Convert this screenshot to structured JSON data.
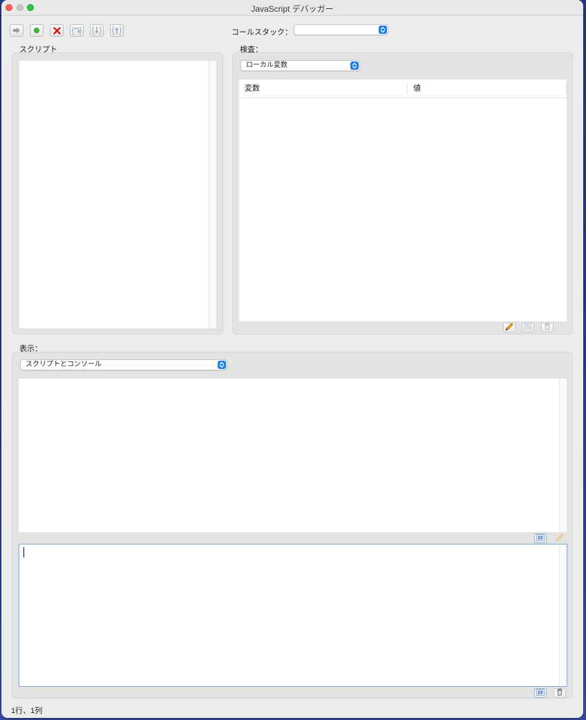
{
  "window": {
    "title": "JavaScript デバッガー"
  },
  "toolbar": {
    "buttons": [
      {
        "name": "continue",
        "icon": "arrow-right-icon"
      },
      {
        "name": "run",
        "icon": "green-dot-icon"
      },
      {
        "name": "stop",
        "icon": "red-x-icon"
      },
      {
        "name": "step-over",
        "icon": "step-over-icon"
      },
      {
        "name": "step-into",
        "icon": "step-into-icon"
      },
      {
        "name": "step-out",
        "icon": "step-out-icon"
      }
    ]
  },
  "callstack": {
    "label": "コールスタック：",
    "value": ""
  },
  "script_panel": {
    "label": "スクリプト"
  },
  "inspect_panel": {
    "label": "検査：",
    "select_value": "ローカル変数",
    "columns": [
      "変数",
      "値"
    ]
  },
  "display_panel": {
    "label": "表示：",
    "select_value": "スクリプトとコンソール"
  },
  "status": {
    "position_text": "1行、1列"
  },
  "colors": {
    "accent": "#1c7cf0",
    "window_bg": "#ececec",
    "group_bg": "#e3e3e3",
    "close": "#fe5f57",
    "maximize": "#2ac840",
    "focus_border": "#7fa7d8"
  }
}
